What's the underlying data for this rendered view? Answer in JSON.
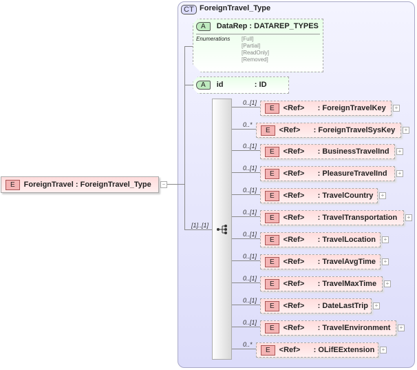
{
  "complex_type": {
    "badge": "CT",
    "name": "ForeignTravel_Type"
  },
  "root": {
    "badge": "E",
    "name": "ForeignTravel",
    "type": ": ForeignTravel_Type",
    "collapse": "−"
  },
  "attributes": [
    {
      "badge": "A",
      "name": "DataRep",
      "type": ": DATAREP_TYPES",
      "enum_label": "Enumerations",
      "enums": [
        "[Full]",
        "[Partial]",
        "[ReadOnly]",
        "[Removed]"
      ]
    },
    {
      "badge": "A",
      "name": "id",
      "type": ": ID"
    }
  ],
  "sequence_multiplicity": "[1]..[1]",
  "elements": [
    {
      "mult": "0..[1]",
      "badge": "E",
      "ref": "<Ref>",
      "name": ": ForeignTravelKey"
    },
    {
      "mult": "0..*",
      "badge": "E",
      "ref": "<Ref>",
      "name": ": ForeignTravelSysKey"
    },
    {
      "mult": "0..[1]",
      "badge": "E",
      "ref": "<Ref>",
      "name": ": BusinessTravelInd"
    },
    {
      "mult": "0..[1]",
      "badge": "E",
      "ref": "<Ref>",
      "name": ": PleasureTravelInd"
    },
    {
      "mult": "0..[1]",
      "badge": "E",
      "ref": "<Ref>",
      "name": ": TravelCountry"
    },
    {
      "mult": "0..[1]",
      "badge": "E",
      "ref": "<Ref>",
      "name": ": TravelTransportation"
    },
    {
      "mult": "0..[1]",
      "badge": "E",
      "ref": "<Ref>",
      "name": ": TravelLocation"
    },
    {
      "mult": "0..[1]",
      "badge": "E",
      "ref": "<Ref>",
      "name": ": TravelAvgTime"
    },
    {
      "mult": "0..[1]",
      "badge": "E",
      "ref": "<Ref>",
      "name": ": TravelMaxTime"
    },
    {
      "mult": "0..[1]",
      "badge": "E",
      "ref": "<Ref>",
      "name": ": DateLastTrip"
    },
    {
      "mult": "0..[1]",
      "badge": "E",
      "ref": "<Ref>",
      "name": ": TravelEnvironment"
    },
    {
      "mult": "0..*",
      "badge": "E",
      "ref": "<Ref>",
      "name": ": OLifEExtension"
    }
  ],
  "expand_symbol": "+"
}
